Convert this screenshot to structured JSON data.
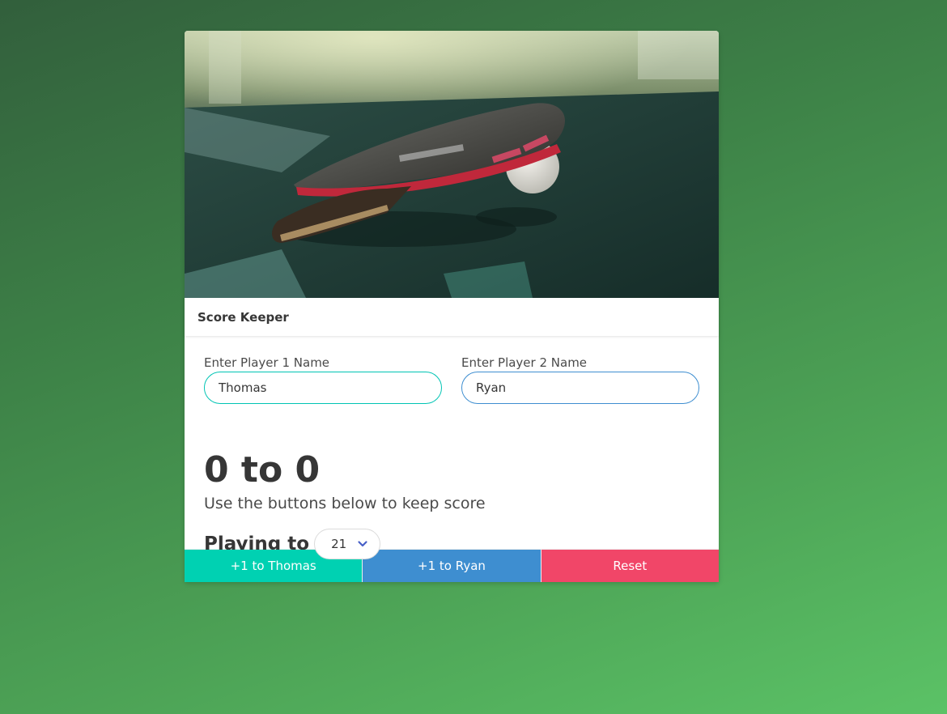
{
  "card": {
    "title": "Score Keeper",
    "image_alt": "ping pong paddle and ball on table"
  },
  "player1": {
    "label": "Enter Player 1 Name",
    "value": "Thomas"
  },
  "player2": {
    "label": "Enter Player 2 Name",
    "value": "Ryan"
  },
  "score": {
    "text": "0 to 0",
    "p1": 0,
    "p2": 0
  },
  "instructions": "Use the buttons below to keep score",
  "playing_to": {
    "label": "Playing to",
    "selected": "21"
  },
  "buttons": {
    "p1_label": "+1 to Thomas",
    "p2_label": "+1 to Ryan",
    "reset_label": "Reset"
  },
  "colors": {
    "p1_button": "#00d1b2",
    "p2_button": "#3e8ed0",
    "reset_button": "#f14668",
    "chevron": "#485fc7"
  },
  "icons": {
    "select_chevron": "chevron-down-icon"
  }
}
